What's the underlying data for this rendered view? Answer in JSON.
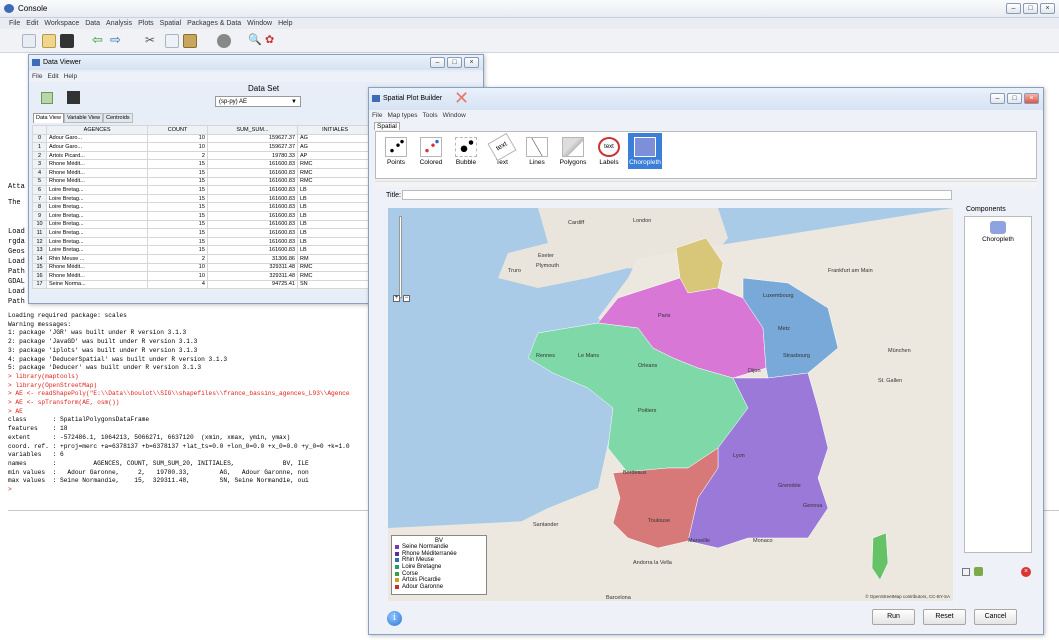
{
  "console": {
    "title": "Console",
    "menu": [
      "File",
      "Edit",
      "Workspace",
      "Data",
      "Analysis",
      "Plots",
      "Spatial",
      "Packages & Data",
      "Window",
      "Help"
    ],
    "left_labels": [
      "Atta",
      "The",
      "Load",
      "rgda",
      "Geos",
      "Load",
      "Path",
      "GDAL",
      "Load",
      "Path"
    ],
    "lines": [
      {
        "t": "Loading required package: scales",
        "red": false
      },
      {
        "t": "Warning messages:",
        "red": false
      },
      {
        "t": "1: package 'JGR' was built under R version 3.1.3",
        "red": false
      },
      {
        "t": "2: package 'JavaGD' was built under R version 3.1.3",
        "red": false
      },
      {
        "t": "3: package 'iplots' was built under R version 3.1.3",
        "red": false
      },
      {
        "t": "4: package 'DeducerSpatial' was built under R version 3.1.3",
        "red": false
      },
      {
        "t": "5: package 'Deducer' was built under R version 3.1.3",
        "red": false
      },
      {
        "t": "> library(maptools)",
        "red": true
      },
      {
        "t": "> library(OpenStreetMap)",
        "red": true
      },
      {
        "t": "> AE <- readShapePoly(\"E:\\\\Data\\\\boulot\\\\SIG\\\\shapefiles\\\\france_bassins_agences_L93\\\\Agence",
        "red": true
      },
      {
        "t": "> AE <- spTransform(AE, osm())",
        "red": true
      },
      {
        "t": "> AE",
        "red": true
      },
      {
        "t": "class       : SpatialPolygonsDataFrame",
        "red": false
      },
      {
        "t": "features    : 18",
        "red": false
      },
      {
        "t": "extent      : -572486.1, 1064213, 5066271, 6637120  (xmin, xmax, ymin, ymax)",
        "red": false
      },
      {
        "t": "coord. ref. : +proj=merc +a=6378137 +b=6378137 +lat_ts=0.0 +lon_0=0.0 +x_0=0.0 +y_0=0 +k=1.0",
        "red": false
      },
      {
        "t": "variables   : 6",
        "red": false
      },
      {
        "t": "names       :          AGENCES, COUNT, SUM_SUM_20, INITIALES,             BV, ILE",
        "red": false
      },
      {
        "t": "min values  :   Adour Garonne,     2,   19780.33,        AG,   Adour Garonne, non",
        "red": false
      },
      {
        "t": "max values  : Seine Normandie,    15,  329311.48,        SN, Seine Normandie, oui",
        "red": false
      },
      {
        "t": ">",
        "red": true
      }
    ]
  },
  "data_viewer": {
    "title": "Data Viewer",
    "menu": [
      "File",
      "Edit",
      "Help"
    ],
    "dataset_label": "Data Set",
    "dataset_value": "(sp-py) AE",
    "tabs": [
      "Data View",
      "Variable View",
      "Centroids"
    ],
    "columns": [
      "",
      "AGENCES",
      "COUNT",
      "SUM_SUM...",
      "INITIALES",
      "BV",
      "ILE"
    ],
    "rows": [
      [
        "0",
        "Adour Garo...",
        "10",
        "159627.37",
        "AG",
        "Adour Garo...",
        "oui"
      ],
      [
        "1",
        "Adour Garo...",
        "10",
        "159627.37",
        "AG",
        "Adour Garo...",
        "non"
      ],
      [
        "2",
        "Artois Picard...",
        "2",
        "19780.33",
        "AP",
        "Artois Picard...",
        "non"
      ],
      [
        "3",
        "Rhone Médit...",
        "15",
        "161600.83",
        "RMC",
        "Rhone Médit...",
        "oui"
      ],
      [
        "4",
        "Rhone Médit...",
        "15",
        "161600.83",
        "RMC",
        "Rhone Médit...",
        "oui"
      ],
      [
        "5",
        "Rhone Médit...",
        "15",
        "161600.83",
        "RMC",
        "Rhone Médit...",
        "oui"
      ],
      [
        "6",
        "Loire Bretag...",
        "15",
        "161600.83",
        "LB",
        "Loire Bretag...",
        "oui"
      ],
      [
        "7",
        "Loire Bretag...",
        "15",
        "161600.83",
        "LB",
        "Loire Bretag...",
        "oui"
      ],
      [
        "8",
        "Loire Bretag...",
        "15",
        "161600.83",
        "LB",
        "Loire Bretag...",
        "oui"
      ],
      [
        "9",
        "Loire Bretag...",
        "15",
        "161600.83",
        "LB",
        "Loire Bretag...",
        "oui"
      ],
      [
        "10",
        "Loire Bretag...",
        "15",
        "161600.83",
        "LB",
        "Loire Bretag...",
        "oui"
      ],
      [
        "11",
        "Loire Bretag...",
        "15",
        "161600.83",
        "LB",
        "Loire Bretag...",
        "oui"
      ],
      [
        "12",
        "Loire Bretag...",
        "15",
        "161600.83",
        "LB",
        "Loire Bretag...",
        "oui"
      ],
      [
        "13",
        "Loire Bretag...",
        "15",
        "161600.83",
        "LB",
        "Loire Bretag...",
        "non"
      ],
      [
        "14",
        "Rhin Meuse ...",
        "2",
        "31306.86",
        "RM",
        "Rhin Meuse ...",
        "non"
      ],
      [
        "15",
        "Rhone Médit...",
        "10",
        "329311.48",
        "RMC",
        "Corse",
        "oui"
      ],
      [
        "16",
        "Rhone Médit...",
        "10",
        "329311.48",
        "RMC",
        "Rhone Médit...",
        "non"
      ],
      [
        "17",
        "Seine Norma...",
        "4",
        "94725.41",
        "SN",
        "Seine Norma...",
        "non"
      ]
    ]
  },
  "spatial": {
    "title": "Spatial Plot Builder",
    "menu": [
      "File",
      "Map types",
      "Tools",
      "Window"
    ],
    "tab": "Spatial",
    "tools": [
      "Points",
      "Colored",
      "Bubble",
      "Text",
      "Lines",
      "Polygons",
      "Labels",
      "Choropleth"
    ],
    "title_label": "Title:",
    "components_label": "Components",
    "component": "Choropleth",
    "buttons": {
      "run": "Run",
      "reset": "Reset",
      "cancel": "Cancel"
    },
    "legend": {
      "title": "BV",
      "items": [
        {
          "label": "Seine Normandie",
          "color": "#7a3aa8"
        },
        {
          "label": "Rhone Méditerranée",
          "color": "#5a2fa0"
        },
        {
          "label": "Rhin Meuse",
          "color": "#2f6fb0"
        },
        {
          "label": "Loire Bretagne",
          "color": "#2a9a6a"
        },
        {
          "label": "Corse",
          "color": "#3aa040"
        },
        {
          "label": "Artois Picardie",
          "color": "#c9a020"
        },
        {
          "label": "Adour Garonne",
          "color": "#c0302c"
        }
      ]
    },
    "region_colors": {
      "SN": "#d877d6",
      "RMC": "#9a79d8",
      "RM": "#79a9d8",
      "LB": "#7ed8a8",
      "CO": "#66c266",
      "AP": "#d8c679",
      "AG": "#d87979"
    },
    "places": [
      "Cardiff",
      "London",
      "Plymouth",
      "Rennes",
      "Le Mans",
      "Orleans",
      "Poitiers",
      "Bordeaux",
      "Santander",
      "Andorra la Vella",
      "Barcelona",
      "Marseille",
      "Monaco",
      "Genova",
      "Lyon",
      "Luxembourg",
      "Metz",
      "Strasbourg",
      "St. Gallen",
      "München",
      "Frankfurt am Main",
      "Truro",
      "Exeter",
      "Paris",
      "Dijon",
      "Grenoble",
      "Toulouse"
    ],
    "attribution": "© OpenStreetMap contributors, CC-BY-SA"
  }
}
